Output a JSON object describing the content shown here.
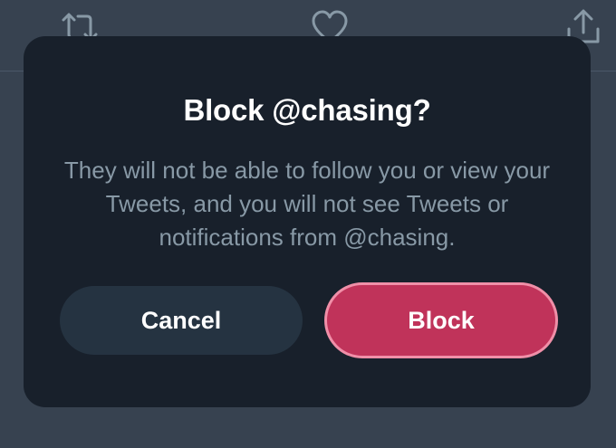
{
  "background": {
    "icons": [
      "retweet-icon",
      "like-icon",
      "share-icon"
    ]
  },
  "dialog": {
    "title": "Block @chasing?",
    "body": "They will not be able to follow you or view your Tweets, and you will not see Tweets or notifications from @chasing.",
    "cancel_label": "Cancel",
    "confirm_label": "Block"
  },
  "colors": {
    "page_background": "#374250",
    "dialog_background": "#18202b",
    "title_text": "#ffffff",
    "body_text": "#8899a6",
    "cancel_button": "#253341",
    "block_button": "#c0335a",
    "block_button_border": "#f08fa8"
  }
}
